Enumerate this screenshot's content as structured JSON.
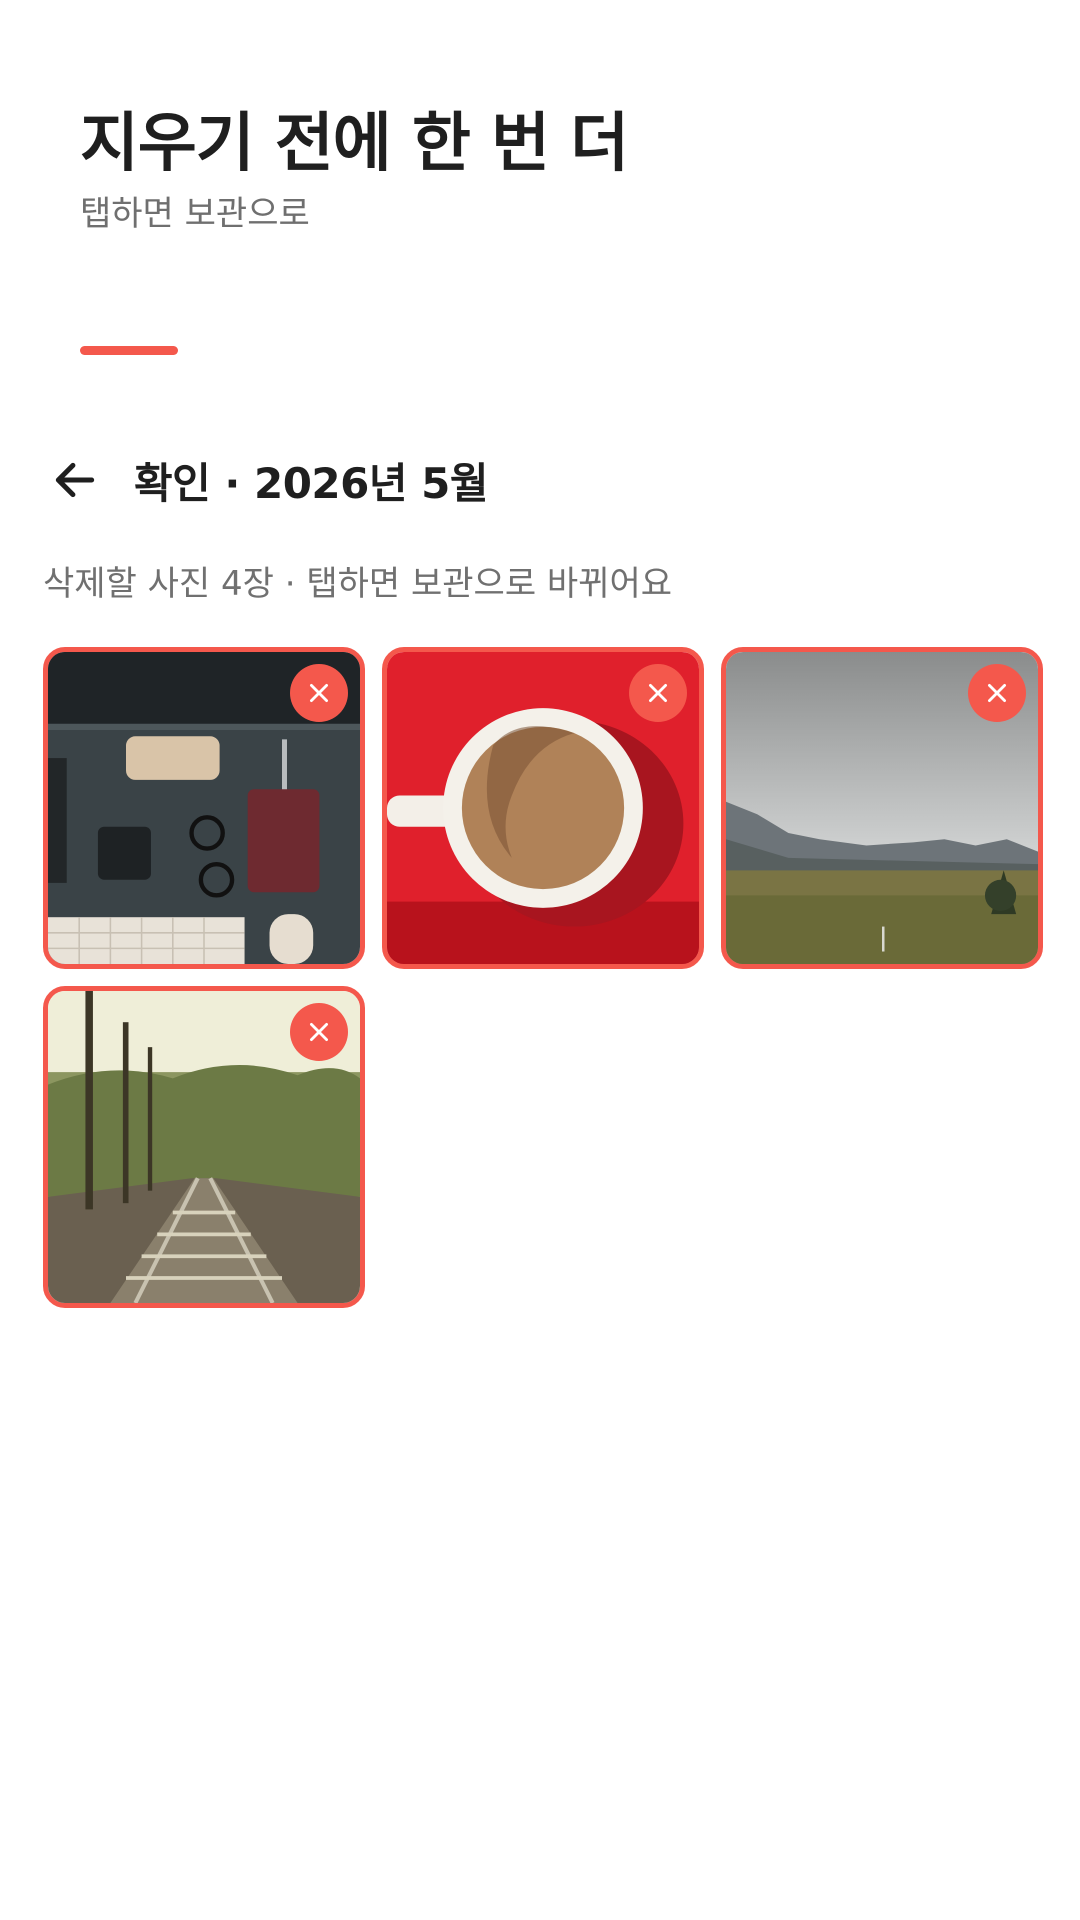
{
  "header": {
    "title": "지우기 전에 한 번 더",
    "subtitle": "탭하면 보관으로"
  },
  "nav": {
    "back_icon": "arrow-left-icon",
    "title": "확인 · 2026년 5월"
  },
  "info": {
    "text": "삭제할 사진 4장 · 탭하면 보관으로 바뀌어요"
  },
  "photos": [
    {
      "subject": "desk-flatlay",
      "remove_icon": "close-icon"
    },
    {
      "subject": "coffee-cup",
      "remove_icon": "close-icon"
    },
    {
      "subject": "landscape-mountains",
      "remove_icon": "close-icon"
    },
    {
      "subject": "railway-tracks",
      "remove_icon": "close-icon"
    }
  ],
  "colors": {
    "accent": "#f4584c",
    "title": "#1f1f1f",
    "secondary_text": "#707070",
    "background": "#ffffff"
  }
}
